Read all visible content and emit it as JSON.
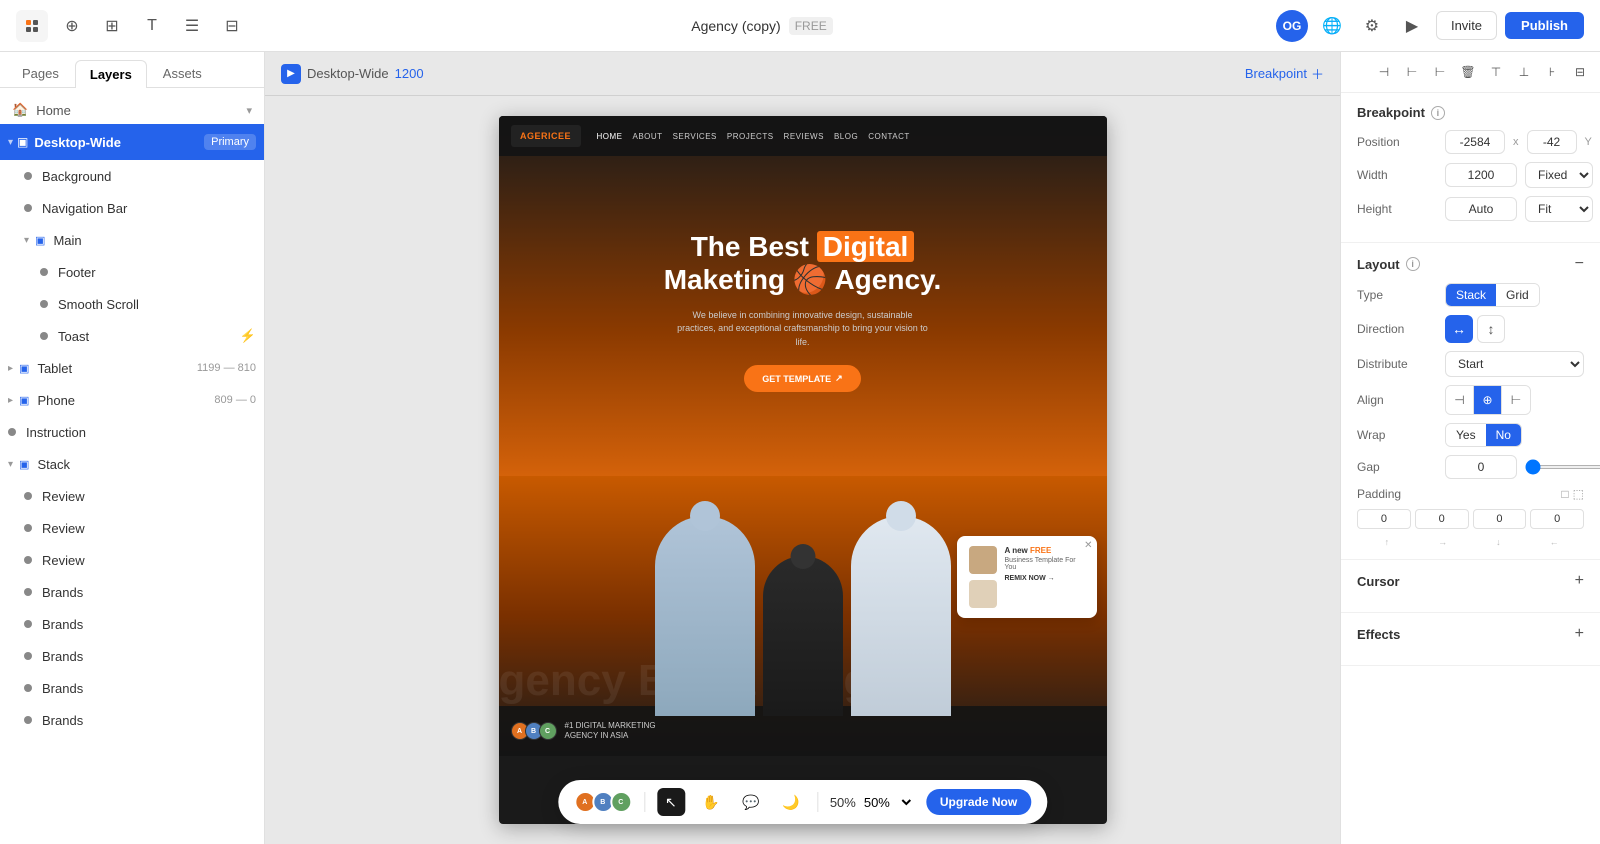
{
  "topbar": {
    "title": "Agency (copy)",
    "badge": "FREE",
    "invite_label": "Invite",
    "publish_label": "Publish",
    "avatar": "OG"
  },
  "left_panel": {
    "tabs": [
      "Pages",
      "Layers",
      "Assets"
    ],
    "active_tab": "Layers",
    "home_label": "Home",
    "layers": [
      {
        "id": "desktop-wide",
        "label": "Desktop-Wide",
        "badge": "Primary",
        "indent": 0,
        "type": "frame",
        "expanded": true
      },
      {
        "id": "background",
        "label": "Background",
        "indent": 1,
        "type": "component"
      },
      {
        "id": "navigation-bar",
        "label": "Navigation Bar",
        "indent": 1,
        "type": "component"
      },
      {
        "id": "main",
        "label": "Main",
        "indent": 1,
        "type": "frame",
        "expanded": true
      },
      {
        "id": "footer",
        "label": "Footer",
        "indent": 2,
        "type": "component"
      },
      {
        "id": "smooth-scroll",
        "label": "Smooth Scroll",
        "indent": 2,
        "type": "component"
      },
      {
        "id": "toast",
        "label": "Toast",
        "indent": 2,
        "type": "component",
        "has_lightning": true
      },
      {
        "id": "tablet",
        "label": "Tablet",
        "indent": 0,
        "type": "frame",
        "count": "1199 — 810"
      },
      {
        "id": "phone",
        "label": "Phone",
        "indent": 0,
        "type": "frame",
        "count": "809 — 0"
      },
      {
        "id": "instruction",
        "label": "Instruction",
        "indent": 0,
        "type": "component"
      },
      {
        "id": "stack",
        "label": "Stack",
        "indent": 0,
        "type": "frame",
        "expanded": true
      },
      {
        "id": "review1",
        "label": "Review",
        "indent": 0,
        "type": "component"
      },
      {
        "id": "review2",
        "label": "Review",
        "indent": 0,
        "type": "component"
      },
      {
        "id": "review3",
        "label": "Review",
        "indent": 0,
        "type": "component"
      },
      {
        "id": "brands1",
        "label": "Brands",
        "indent": 0,
        "type": "component"
      },
      {
        "id": "brands2",
        "label": "Brands",
        "indent": 0,
        "type": "component"
      },
      {
        "id": "brands3",
        "label": "Brands",
        "indent": 0,
        "type": "component"
      },
      {
        "id": "brands4",
        "label": "Brands",
        "indent": 0,
        "type": "component"
      },
      {
        "id": "brands5",
        "label": "Brands",
        "indent": 0,
        "type": "component"
      }
    ]
  },
  "canvas": {
    "label": "Desktop-Wide",
    "width": "1200",
    "breakpoint_label": "Breakpoint"
  },
  "preview": {
    "nav_links": [
      "HOME",
      "ABOUT",
      "SERVICES",
      "PROJECTS",
      "REVIEWS",
      "BLOG",
      "CONTACT"
    ],
    "hero_title_1": "The Best",
    "hero_title_highlight": "Digital",
    "hero_title_2": "Maketing",
    "hero_title_emoji": "🏀",
    "hero_title_3": "Agency.",
    "hero_subtitle": "We believe in combining innovative design, sustainable practices, and exceptional craftsmanship to bring your vision to life.",
    "cta_label": "GET TEMPLATE",
    "toast_title": "A new",
    "toast_free": "FREE",
    "toast_body": "Business Template For You",
    "toast_action": "REMIX NOW →",
    "marquee_text": "gency  Bes  a  leti  ger",
    "bottom_text_1": "#1 DIGITAL MARKETING",
    "bottom_text_2": "AGENCY IN ASIA"
  },
  "bottom_toolbar": {
    "tools": [
      "cursor",
      "hand",
      "comment",
      "dark-mode"
    ],
    "zoom": "50%",
    "upgrade_label": "Upgrade Now"
  },
  "right_panel": {
    "section_breakpoint": {
      "title": "Breakpoint",
      "position_x": "-2584",
      "position_y": "-42",
      "width_value": "1200",
      "width_mode": "Fixed",
      "height_value": "Auto",
      "height_mode": "Fit"
    },
    "section_layout": {
      "title": "Layout",
      "type_stack": "Stack",
      "type_grid": "Grid",
      "direction_horizontal": "↔",
      "direction_vertical": "↕",
      "distribute": "Start",
      "align_options": [
        "left",
        "center",
        "right"
      ],
      "wrap_yes": "Yes",
      "wrap_no": "No",
      "gap": "0",
      "padding_top": "0",
      "padding_right": "0",
      "padding_bottom": "0",
      "padding_left": "0"
    },
    "section_cursor": {
      "title": "Cursor"
    },
    "section_effects": {
      "title": "Effects"
    }
  }
}
